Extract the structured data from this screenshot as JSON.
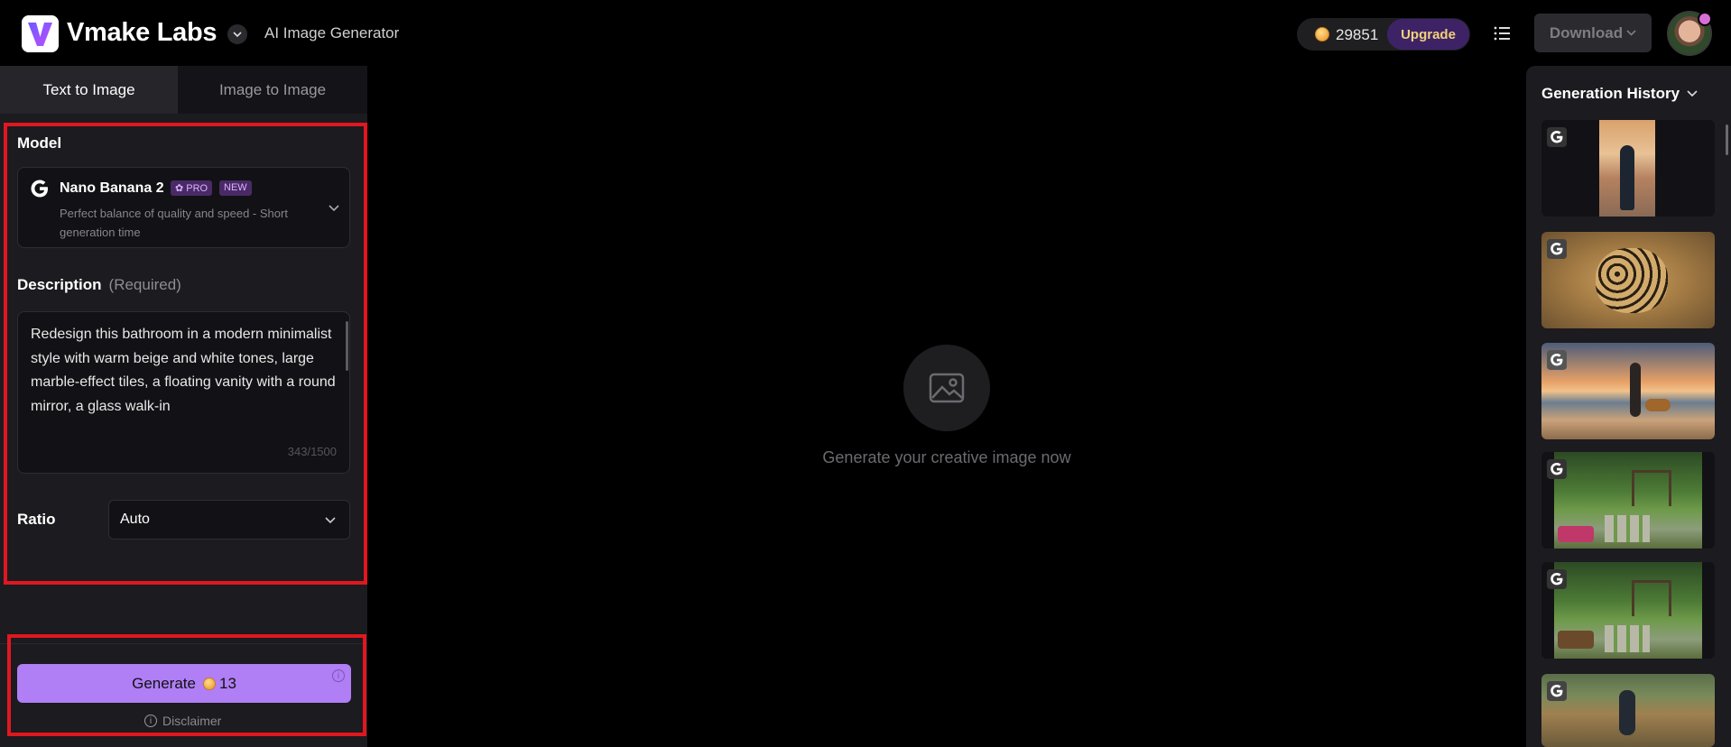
{
  "header": {
    "brand": "Vmake Labs",
    "subtitle": "AI Image Generator",
    "credits": "29851",
    "upgrade_label": "Upgrade",
    "download_label": "Download"
  },
  "tabs": [
    {
      "label": "Text to Image",
      "active": true
    },
    {
      "label": "Image to Image",
      "active": false
    }
  ],
  "model": {
    "section_label": "Model",
    "name": "Nano Banana 2",
    "pro_badge": "✿ PRO",
    "new_badge": "NEW",
    "description": "Perfect balance of quality and speed - Short generation time",
    "icon": "google-g-icon"
  },
  "description": {
    "section_label": "Description",
    "required_label": "(Required)",
    "value": "Redesign this bathroom in a modern minimalist style with warm beige and white tones, large marble-effect tiles, a floating vanity with a round mirror, a glass walk-in",
    "char_count": "343/1500"
  },
  "ratio": {
    "section_label": "Ratio",
    "value": "Auto"
  },
  "generate": {
    "label": "Generate",
    "cost": "13",
    "disclaimer": "Disclaimer"
  },
  "canvas": {
    "empty_text": "Generate your creative image now",
    "icon": "image-placeholder-icon"
  },
  "history": {
    "title": "Generation History",
    "items": [
      {
        "subject": "woman in dress at sunset"
      },
      {
        "subject": "leopard in grass"
      },
      {
        "subject": "woman walking dog on beach"
      },
      {
        "subject": "garden with stone path and pergola"
      },
      {
        "subject": "garden with stone path and pergola"
      },
      {
        "subject": "man jogging in forest"
      }
    ]
  },
  "colors": {
    "accent": "#b07ef5",
    "upgrade_bg": "#3d2366",
    "highlight": "#e0171f"
  }
}
